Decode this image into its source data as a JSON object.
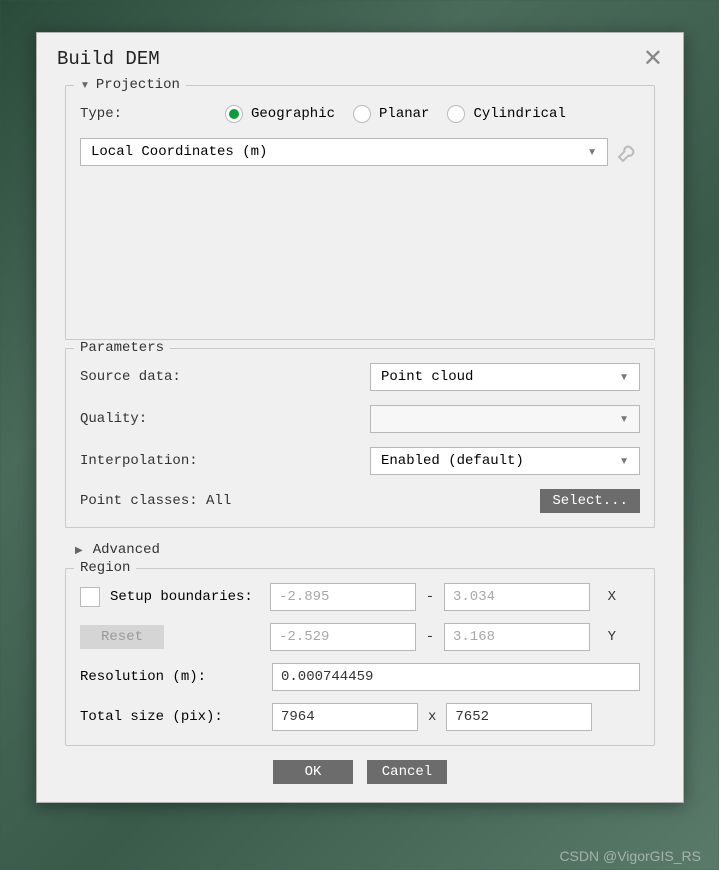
{
  "dialog": {
    "title": "Build DEM",
    "projection": {
      "legend": "Projection",
      "type_label": "Type:",
      "options": {
        "geographic": "Geographic",
        "planar": "Planar",
        "cylindrical": "Cylindrical"
      },
      "selected": "geographic",
      "coord_system": "Local Coordinates (m)"
    },
    "parameters": {
      "legend": "Parameters",
      "source_data_label": "Source data:",
      "source_data_value": "Point cloud",
      "quality_label": "Quality:",
      "quality_value": "",
      "interpolation_label": "Interpolation:",
      "interpolation_value": "Enabled (default)",
      "point_classes_label": "Point classes: All",
      "select_button": "Select..."
    },
    "advanced": {
      "legend": "Advanced"
    },
    "region": {
      "legend": "Region",
      "setup_boundaries_label": "Setup boundaries:",
      "x_min": "-2.895",
      "x_max": "3.034",
      "x_axis": "X",
      "y_min": "-2.529",
      "y_max": "3.168",
      "y_axis": "Y",
      "reset_button": "Reset",
      "resolution_label": "Resolution (m):",
      "resolution_value": "0.000744459",
      "total_size_label": "Total size (pix):",
      "total_size_w": "7964",
      "total_size_sep": "x",
      "total_size_h": "7652"
    },
    "footer": {
      "ok": "OK",
      "cancel": "Cancel"
    }
  },
  "watermark": "CSDN @VigorGIS_RS"
}
